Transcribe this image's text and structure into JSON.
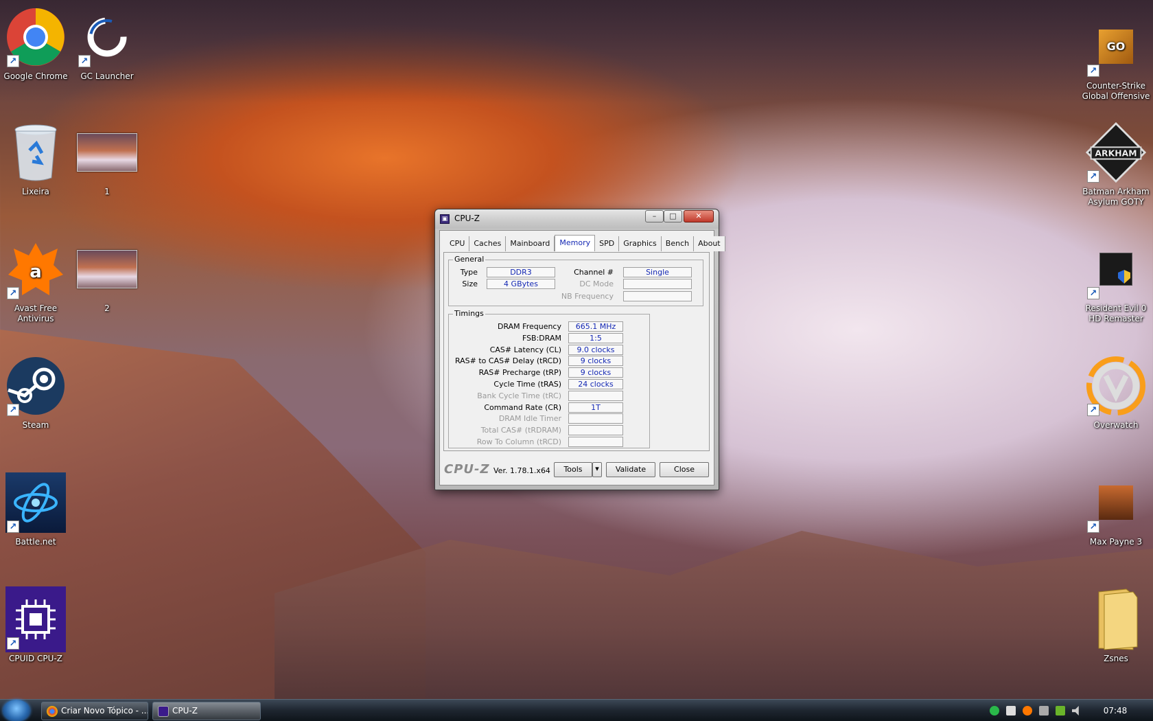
{
  "desktop": {
    "icons_left": [
      {
        "label": "Google Chrome",
        "icon": "chrome-icon"
      },
      {
        "label": "GC Launcher",
        "icon": "gc-launcher-icon"
      },
      {
        "label": "Lixeira",
        "icon": "recycle-bin-icon"
      },
      {
        "label": "1",
        "icon": "screenshot-thumbnail-icon"
      },
      {
        "label": "Avast Free Antivirus",
        "icon": "avast-icon"
      },
      {
        "label": "2",
        "icon": "screenshot-thumbnail-icon"
      },
      {
        "label": "Steam",
        "icon": "steam-icon"
      },
      {
        "label": "Battle.net",
        "icon": "battlenet-icon"
      },
      {
        "label": "CPUID CPU-Z",
        "icon": "cpuz-icon"
      }
    ],
    "icons_right": [
      {
        "label": "Counter-Strike Global Offensive",
        "icon": "csgo-icon"
      },
      {
        "label": "Batman Arkham Asylum GOTY",
        "icon": "arkham-icon"
      },
      {
        "label": "Resident Evil 0 HD Remaster",
        "icon": "resident-evil-icon"
      },
      {
        "label": "Overwatch",
        "icon": "overwatch-icon"
      },
      {
        "label": "Max Payne 3",
        "icon": "max-payne-icon"
      },
      {
        "label": "Zsnes",
        "icon": "folder-icon"
      }
    ],
    "shortcut_arrow": "↗"
  },
  "cpuz": {
    "title": "CPU-Z",
    "tabs": [
      "CPU",
      "Caches",
      "Mainboard",
      "Memory",
      "SPD",
      "Graphics",
      "Bench",
      "About"
    ],
    "active_tab": "Memory",
    "general": {
      "label": "General",
      "type_label": "Type",
      "type_value": "DDR3",
      "size_label": "Size",
      "size_value": "4 GBytes",
      "channel_label": "Channel #",
      "channel_value": "Single",
      "dcmode_label": "DC Mode",
      "dcmode_value": "",
      "nbfreq_label": "NB Frequency",
      "nbfreq_value": ""
    },
    "timings": {
      "label": "Timings",
      "rows": [
        {
          "label": "DRAM Frequency",
          "value": "665.1 MHz",
          "dim": false
        },
        {
          "label": "FSB:DRAM",
          "value": "1:5",
          "dim": false
        },
        {
          "label": "CAS# Latency (CL)",
          "value": "9.0 clocks",
          "dim": false
        },
        {
          "label": "RAS# to CAS# Delay (tRCD)",
          "value": "9 clocks",
          "dim": false
        },
        {
          "label": "RAS# Precharge (tRP)",
          "value": "9 clocks",
          "dim": false
        },
        {
          "label": "Cycle Time (tRAS)",
          "value": "24 clocks",
          "dim": false
        },
        {
          "label": "Bank Cycle Time (tRC)",
          "value": "",
          "dim": true
        },
        {
          "label": "Command Rate (CR)",
          "value": "1T",
          "dim": false
        },
        {
          "label": "DRAM Idle Timer",
          "value": "",
          "dim": true
        },
        {
          "label": "Total CAS# (tRDRAM)",
          "value": "",
          "dim": true
        },
        {
          "label": "Row To Column (tRCD)",
          "value": "",
          "dim": true
        }
      ]
    },
    "footer": {
      "brand": "CPU-Z",
      "version": "Ver. 1.78.1.x64",
      "tools_label": "Tools",
      "validate_label": "Validate",
      "close_label": "Close"
    },
    "window_buttons": {
      "minimize": "–",
      "maximize": "□",
      "close": "✕"
    }
  },
  "taskbar": {
    "items": [
      {
        "label": "Criar Novo Tópico - ...",
        "icon": "chrome-icon"
      },
      {
        "label": "CPU-Z",
        "icon": "cpuz-icon"
      }
    ],
    "clock": "07:48"
  }
}
